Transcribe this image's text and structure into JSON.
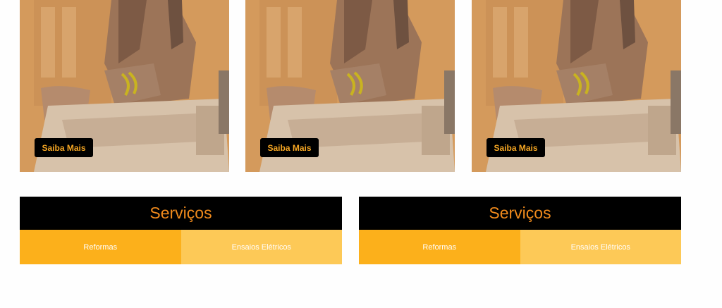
{
  "cards": [
    {
      "button_label": "Saiba Mais"
    },
    {
      "button_label": "Saiba Mais"
    },
    {
      "button_label": "Saiba Mais"
    }
  ],
  "services": [
    {
      "title": "Serviços",
      "tabs": [
        {
          "label": "Reformas"
        },
        {
          "label": "Ensaios Elétricos"
        }
      ]
    },
    {
      "title": "Serviços",
      "tabs": [
        {
          "label": "Reformas"
        },
        {
          "label": "Ensaios Elétricos"
        }
      ]
    }
  ],
  "colors": {
    "accent_orange": "#f08a1c",
    "button_text": "#f5a623",
    "tab_dark": "#fcb01b",
    "tab_light": "#fdc957",
    "black": "#000000"
  }
}
